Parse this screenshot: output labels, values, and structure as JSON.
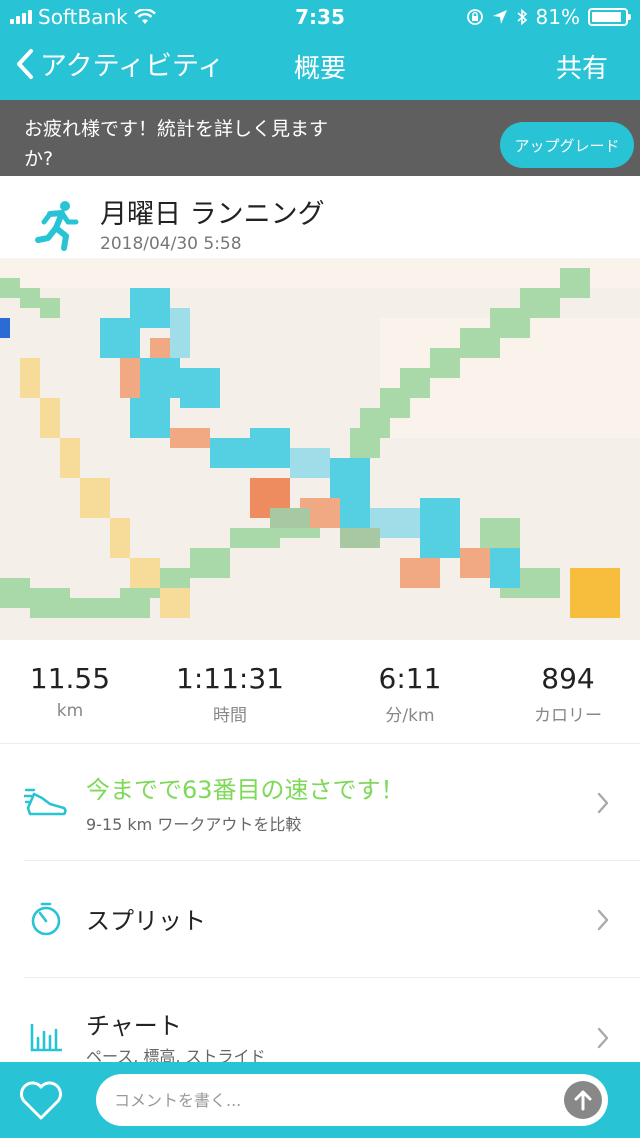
{
  "status": {
    "carrier": "SoftBank",
    "time": "7:35",
    "battery": "81%",
    "battery_level": 0.81
  },
  "nav": {
    "back_label": "アクティビティ",
    "title": "概要",
    "share_label": "共有"
  },
  "banner": {
    "message": "お疲れ様です！統計を詳しく見ますか?",
    "upgrade_label": "アップグレード"
  },
  "activity": {
    "name": "月曜日 ランニング",
    "datetime": "2018/04/30 5:58",
    "icon": "running-icon"
  },
  "stats": [
    {
      "value": "11.55",
      "unit": "km"
    },
    {
      "value": "1:11:31",
      "unit": "時間"
    },
    {
      "value": "6:11",
      "unit": "分/km"
    },
    {
      "value": "894",
      "unit": "カロリー"
    }
  ],
  "rows": {
    "compare": {
      "title": "今までで63番目の速さです！",
      "subtitle": "9-15 km ワークアウトを比較",
      "icon": "shoe-icon"
    },
    "splits": {
      "title": "スプリット",
      "icon": "stopwatch-icon"
    },
    "charts": {
      "title": "チャート",
      "subtitle": "ペース, 標高, ストライド",
      "icon": "chart-icon"
    }
  },
  "comment": {
    "placeholder": "コメントを書く..."
  },
  "colors": {
    "accent": "#29c3d6",
    "banner": "#5f5f5f",
    "highlight_green": "#7ed957"
  }
}
